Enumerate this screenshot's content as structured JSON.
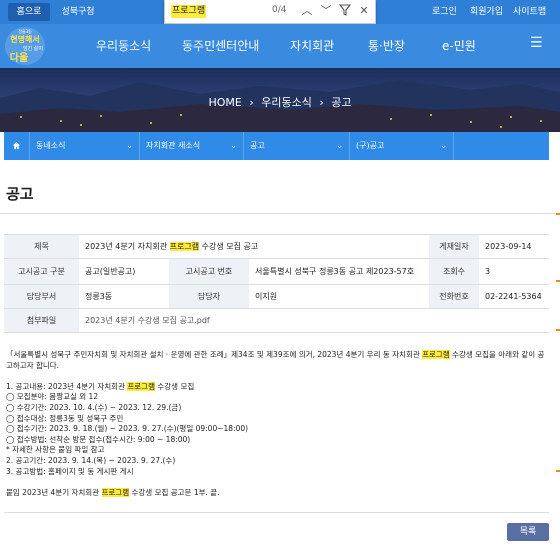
{
  "topbar": {
    "home": "홈으로",
    "gu": "성북구청",
    "login": "로그인",
    "join": "회원가입",
    "sitemap": "사이트맵"
  },
  "find": {
    "query": "프로그램",
    "count": "0/4"
  },
  "logo": {
    "line1": "정릉3동",
    "line2": "현명해서",
    "line3": "담긴 삶이",
    "line4": "다울"
  },
  "nav": [
    "우리동소식",
    "동주민센터안내",
    "자치회관",
    "통·반장",
    "e-민원"
  ],
  "breadcrumb": [
    "HOME",
    "우리동소식",
    "공고"
  ],
  "subnav": [
    "동네소식",
    "자치회관 새소식",
    "공고",
    "(구)공고"
  ],
  "page_title": "공고",
  "info": {
    "title_label": "제목",
    "title_pre": "2023년 4분기 자치회관 ",
    "title_hl": "프로그램",
    "title_post": " 수강생 모집 공고",
    "date_label": "게재일자",
    "date": "2023-09-14",
    "kind_label": "고시공고 구분",
    "kind": "공고(일반공고)",
    "no_label": "고시공고 번호",
    "no": "서울특별시 성북구 정릉3동 공고 제2023-57호",
    "views_label": "조회수",
    "views": "3",
    "dept_label": "담당부서",
    "dept": "정릉3동",
    "person_label": "담당자",
    "person": "이지원",
    "phone_label": "전화번호",
    "phone": "02-2241-5364",
    "file_label": "첨부파일",
    "file": "2023년 4분기 수강생 모집 공고.pdf"
  },
  "body": {
    "intro_pre": "「서울특별시 성북구 주민자치회 및 자치회관 설치 · 운영에 관한 조례」제34조 및 제39조에 의거, 2023년 4분기 우리 동 자치회관 ",
    "intro_post": " 수강생 모집을 아래와 같이 공고하고자 합니다.",
    "l1_pre": "1. 공고내용: 2023년 4분기 자치회관 ",
    "l1_post": " 수강생 모집",
    "l2": "◯ 모집분야: 몸짱교실 외 12",
    "l3": "◯ 수강기간: 2023. 10. 4.(수) ~ 2023. 12. 29.(금)",
    "l4": "◯ 접수대상: 정릉3동 및 성북구 주민",
    "l5": "◯ 접수기간: 2023. 9. 18.(월) ~ 2023. 9. 27.(수)(평일 09:00~18:00)",
    "l6": "◯ 접수방법: 선착순 방문 접수(접수시간: 9:00 ~ 18:00)",
    "l7": "* 자세한 사항은 붙임 파일 참고",
    "l8": "2. 공고기간: 2023. 9. 14.(목) ~ 2023. 9. 27.(수)",
    "l9": "3. 공고방법: 홈페이지 및 동 게시판 게시",
    "l10_pre": "붙임 2023년 4분기 자치회관 ",
    "l10_post": " 수강생 모집 공고문 1부. 끝."
  },
  "list_button": "목록"
}
